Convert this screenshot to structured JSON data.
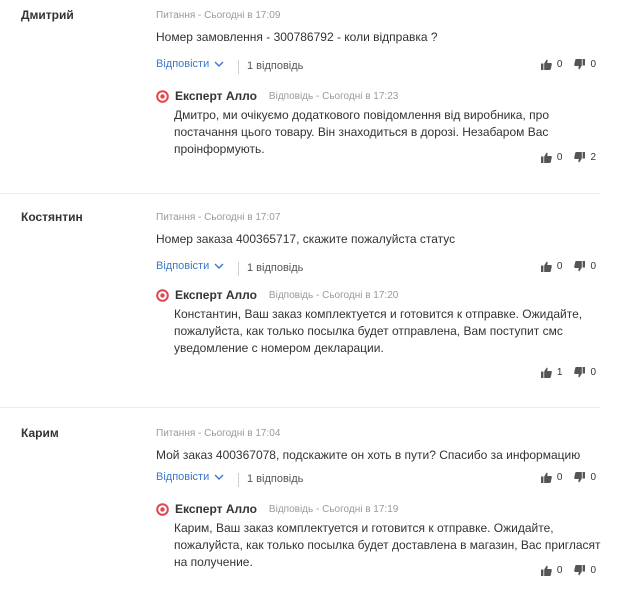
{
  "common": {
    "reply_label": "Відповісти",
    "expert_name": "Експерт Алло"
  },
  "posts": [
    {
      "author": "Дмитрий",
      "meta": "Питання - Сьогодні в 17:09",
      "text": "Номер замовлення - 300786792 - коли відправка ?",
      "replies_count": "1 відповідь",
      "likes": "0",
      "dislikes": "0",
      "answer": {
        "meta": "Відповідь - Сьогодні в 17:23",
        "text": "Дмитро, ми очікуємо додаткового повідомлення від виробника, про постачання цього товару. Він знаходиться в дорозі. Незабаром Вас проінформують.",
        "likes": "0",
        "dislikes": "2"
      }
    },
    {
      "author": "Костянтин",
      "meta": "Питання - Сьогодні в 17:07",
      "text": "Номер заказа 400365717, скажите пожалуйста статус",
      "replies_count": "1 відповідь",
      "likes": "0",
      "dislikes": "0",
      "answer": {
        "meta": "Відповідь - Сьогодні в 17:20",
        "text": "Константин, Ваш заказ комплектуется и готовится к отправке. Ожидайте, пожалуйста, как только посылка будет отправлена, Вам поступит смс уведомление с номером декларации.",
        "likes": "1",
        "dislikes": "0"
      }
    },
    {
      "author": "Карим",
      "meta": "Питання - Сьогодні в 17:04",
      "text": "Мой заказ 400367078, подскажите он хоть в пути? Спасибо за информацию",
      "replies_count": "1 відповідь",
      "likes": "0",
      "dislikes": "0",
      "answer": {
        "meta": "Відповідь - Сьогодні в 17:19",
        "text": "Карим, Ваш заказ комплектуется и готовится к отправке. Ожидайте, пожалуйста, как только посылка будет доставлена в магазин, Вас пригласят на получение.",
        "likes": "0",
        "dislikes": "0"
      }
    }
  ]
}
